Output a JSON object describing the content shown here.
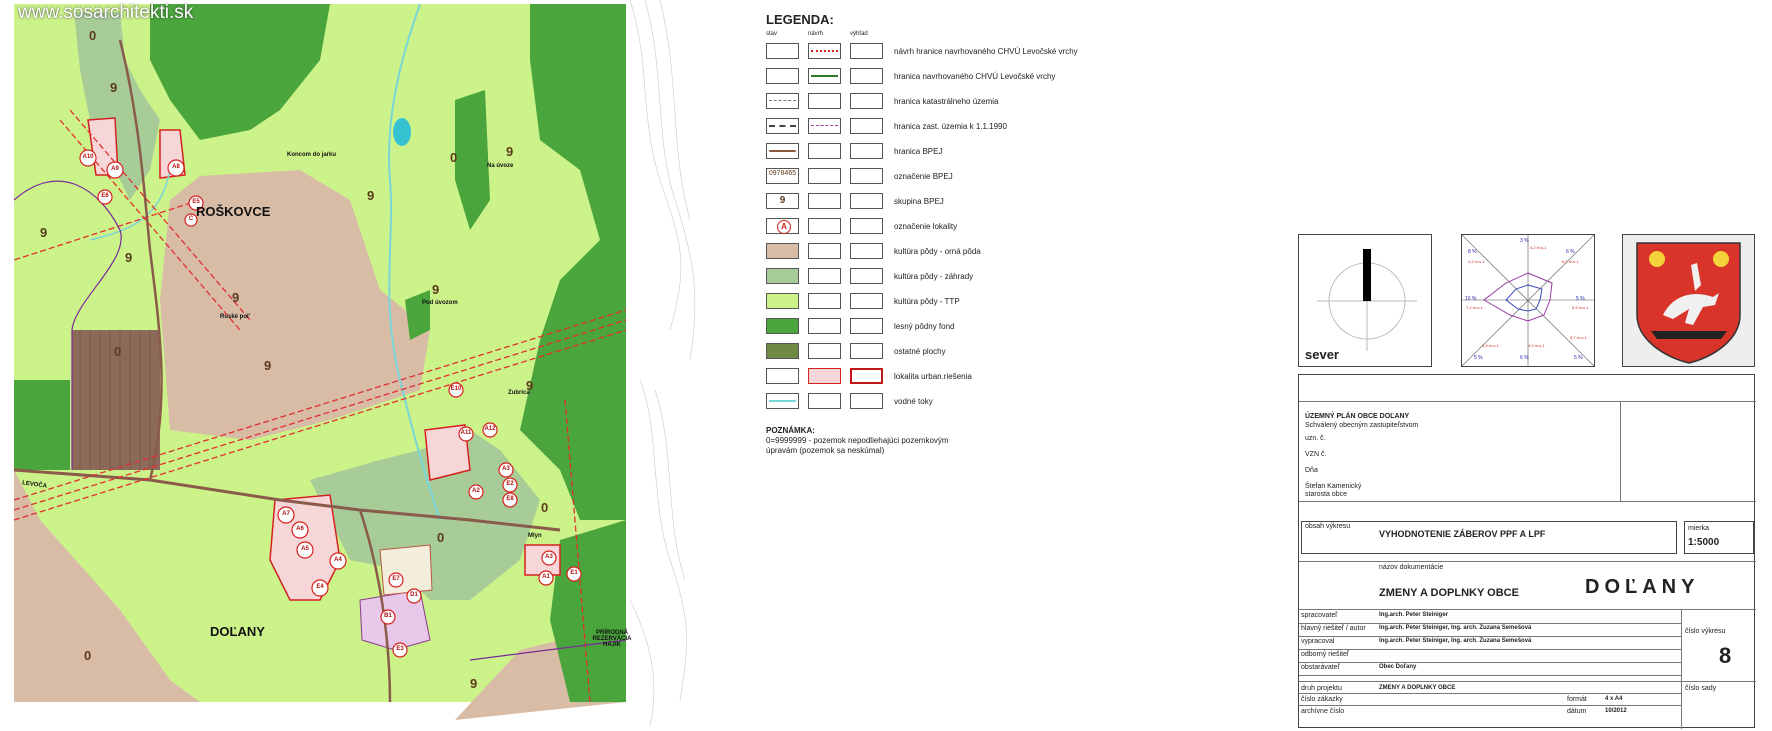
{
  "map": {
    "watermark": "www.sosarchitekti.sk",
    "labels": {
      "roskovce": "ROŠKOVCE",
      "dolany": "DOĽANY",
      "koncom_jarku": "Koncom do jarku",
      "na_cvoze": "Na úvoze",
      "ruske_pol": "Ruské pol'",
      "pod_cvozom": "Pod úvozom",
      "zubrica": "Zubrica",
      "mlyn": "Mlyn",
      "levoca": "LEVOČA",
      "rezervacia": "PRÍRODNÁ REZERVÁCIA HÁJIK"
    },
    "group_numbers": [
      "9",
      "9",
      "9",
      "9",
      "9",
      "9",
      "9",
      "9",
      "9",
      "9",
      "0",
      "0",
      "0",
      "0",
      "0",
      "0"
    ],
    "localities": [
      "A10",
      "A9",
      "A8",
      "E6",
      "E5",
      "C",
      "A11",
      "A12",
      "E10",
      "A2",
      "A3",
      "E2",
      "E8",
      "A3",
      "A1",
      "E1",
      "A7",
      "A6",
      "A5",
      "A4",
      "E4",
      "E7",
      "D1",
      "B1",
      "E3"
    ]
  },
  "legend": {
    "title": "LEGENDA:",
    "col_stav": "stav",
    "col_navrh": "návrh",
    "col_vyhlad": "výhľad",
    "items": [
      {
        "label": "návrh hranice navrhovaného CHVÚ Levočské vrchy"
      },
      {
        "label": "hranica navrhovaného CHVÚ Levočské vrchy"
      },
      {
        "label": "hranica katastrálneho územia"
      },
      {
        "label": "hranica zast. územia k 1.1.1990"
      },
      {
        "label": "hranica BPEJ"
      },
      {
        "label": "označenie BPEJ",
        "sample": "0978465"
      },
      {
        "label": "skupina BPEJ",
        "sample": "9"
      },
      {
        "label": "označenie lokality",
        "sample": "A"
      },
      {
        "label": "kultúra pôdy - orná pôda"
      },
      {
        "label": "kultúra pôdy - záhrady"
      },
      {
        "label": "kultúra pôdy - TTP"
      },
      {
        "label": "lesný pôdny fond"
      },
      {
        "label": "ostatné plochy"
      },
      {
        "label": "lokalita urban.riešenia"
      },
      {
        "label": "vodné toky"
      }
    ],
    "colors": {
      "orna": "#d8bca6",
      "zahrady": "#a8cc98",
      "ttp": "#ccf28a",
      "lesny": "#4aa63c",
      "ostatne": "#6f8a44"
    }
  },
  "note": {
    "title": "POZNÁMKA:",
    "text1": "0=9999999 - pozemok nepodliehajúci pozemkovým",
    "text2": "úpravám (pozemok sa neskúmal)"
  },
  "compass": {
    "label": "sever"
  },
  "windrose": {
    "values": [
      "3 %",
      "6 %",
      "8 %",
      "5 %",
      "10 %",
      "5 %",
      "6 %",
      "5 %",
      "5 %"
    ],
    "speeds": [
      "4,2 m.s-1",
      "6,2 m.s-1",
      "4,2 m.s-1",
      "7,2 m.s-1",
      "5,9 m.s-1",
      "6,9 m.s-1",
      "4,2 m.s-1",
      "3,7 m.s-1"
    ]
  },
  "titleblock": {
    "project": "ÚZEMNÝ PLÁN OBCE DOĽANY",
    "approved": "Schválený obecným zastupiteľstvom",
    "uzn": "uzn. č.",
    "vzn": "VZN č.",
    "dna": "Dňa",
    "mayor": "Štefan Kamenický",
    "mayor_role": "starosta obce",
    "obsah_label": "obsah výkresu",
    "obsah": "VYHODNOTENIE ZÁBEROV PPF A LPF",
    "mierka_label": "mierka",
    "mierka": "1:5000",
    "nazov_label": "názov dokumentácie",
    "nazov": "ZMENY A DOPLNKY OBCE",
    "nazov_big": "DOĽANY",
    "rows": [
      {
        "label": "spracovateľ",
        "value": "Ing.arch. Peter Steiniger"
      },
      {
        "label": "hlavný riešiteľ / autor",
        "value": "Ing.arch. Peter Steiniger, Ing. arch. Zuzana Semešová"
      },
      {
        "label": "vypracoval",
        "value": "Ing.arch. Peter Steiniger, Ing. arch. Zuzana Semešová"
      },
      {
        "label": "odborný riešiteľ",
        "value": ""
      },
      {
        "label": "obstarávateľ",
        "value": "Obec Doľany"
      }
    ],
    "cislo_vykresu_label": "číslo výkresu",
    "cislo_vykresu": "8",
    "druh_label": "druh projektu",
    "druh": "ZMENY A DOPLNKY OBCE",
    "cislo_sady_label": "číslo sady",
    "cislo_zakazky_label": "číslo zákazky",
    "format_label": "formát",
    "format": "4 x A4",
    "archivne_label": "archívne číslo",
    "datum_label": "dátum",
    "datum": "10/2012"
  }
}
